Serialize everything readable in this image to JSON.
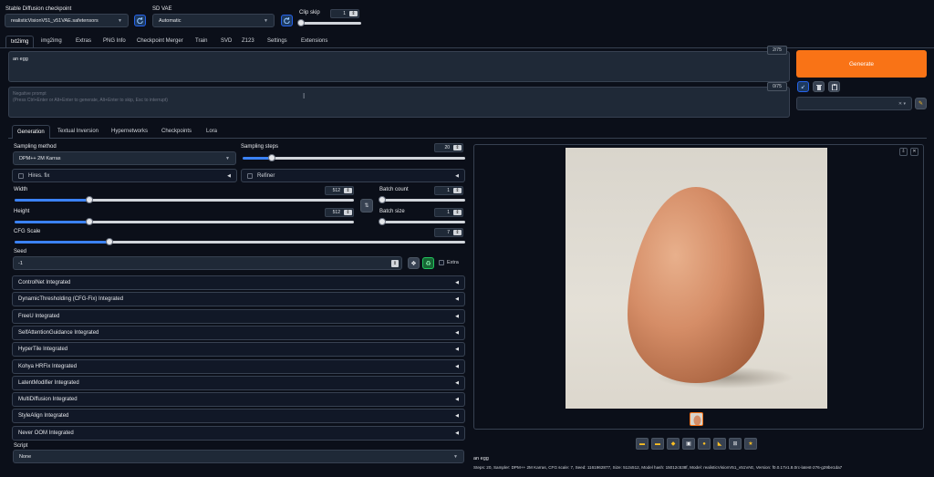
{
  "header": {
    "checkpoint_label": "Stable Diffusion checkpoint",
    "checkpoint_value": "realisticVisionV51_v51VAE.safetensors",
    "vae_label": "SD VAE",
    "vae_value": "Automatic",
    "clip_skip_label": "Clip skip",
    "clip_skip_value": "1",
    "clip_skip_level": 0.0
  },
  "tabs": [
    "txt2img",
    "img2img",
    "Extras",
    "PNG Info",
    "Checkpoint Merger",
    "Train",
    "SVD",
    "Z123",
    "Settings",
    "Extensions"
  ],
  "prompt": {
    "value": "an egg",
    "counter": "2/75"
  },
  "negative_prompt": {
    "placeholder": "Negative prompt\n(Press Ctrl+Enter or Alt+Enter to generate, Alt+Enter to skip, Esc to interrupt)",
    "counter": "0/75"
  },
  "generate_label": "Generate",
  "subtabs": [
    "Generation",
    "Textual Inversion",
    "Hypernetworks",
    "Checkpoints",
    "Lora"
  ],
  "params": {
    "sampling_method_label": "Sampling method",
    "sampling_method_value": "DPM++ 2M Karras",
    "sampling_steps_label": "Sampling steps",
    "sampling_steps_value": "20",
    "sampling_steps_level": 0.13,
    "hires_label": "Hires. fix",
    "refiner_label": "Refiner",
    "width_label": "Width",
    "width_value": "512",
    "width_level": 0.22,
    "height_label": "Height",
    "height_value": "512",
    "height_level": 0.22,
    "batch_count_label": "Batch count",
    "batch_count_value": "1",
    "batch_count_level": 0.0,
    "batch_size_label": "Batch size",
    "batch_size_value": "1",
    "batch_size_level": 0.0,
    "cfg_label": "CFG Scale",
    "cfg_value": "7",
    "cfg_level": 0.21,
    "seed_label": "Seed",
    "seed_value": "-1",
    "extra_label": "Extra"
  },
  "accordions": [
    "ControlNet Integrated",
    "DynamicThresholding (CFG-Fix) Integrated",
    "FreeU Integrated",
    "SelfAttentionGuidance Integrated",
    "HyperTile Integrated",
    "Kohya HRFix Integrated",
    "LatentModifier Integrated",
    "MultiDiffusion Integrated",
    "StyleAlign Integrated",
    "Never OOM Integrated"
  ],
  "script_label": "Script",
  "script_value": "None",
  "output": {
    "caption": "an egg",
    "info": "Steps: 20, Sampler: DPM++ 2M Karras, CFG scale: 7, Seed: 1161962877, Size: 512x512, Model hash: 15012c538f, Model: realisticVisionV51_v51VAE, Version: f0.0.17v1.8.0rc-latest-276-g29be1da7"
  },
  "colors": {
    "accent": "#f97316",
    "background": "#0b0f19",
    "panel": "#1f2937",
    "slider": "#3b82f6"
  }
}
